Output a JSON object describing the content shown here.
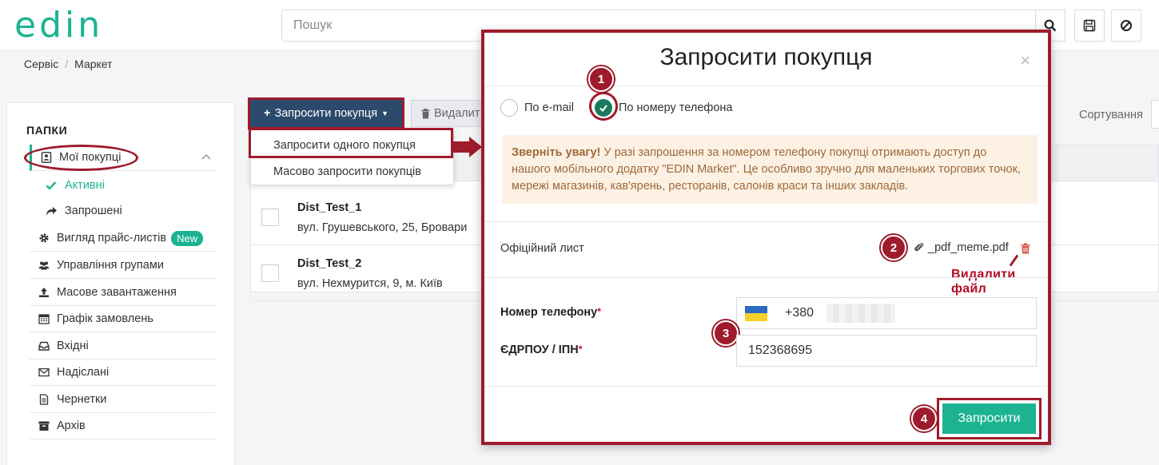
{
  "header": {
    "logo": "edin",
    "search_placeholder": "Пошук"
  },
  "breadcrumb": [
    "Сервіс",
    "Маркет"
  ],
  "sidebar": {
    "title": "ПАПКИ",
    "items": [
      {
        "label": "Мої покупці"
      },
      {
        "label": "Активні"
      },
      {
        "label": "Запрошені"
      },
      {
        "label": "Вигляд прайс-листів",
        "badge": "New"
      },
      {
        "label": "Управління групами"
      },
      {
        "label": "Масове завантаження"
      },
      {
        "label": "Графік замовлень"
      },
      {
        "label": "Вхідні"
      },
      {
        "label": "Надіслані"
      },
      {
        "label": "Чернетки"
      },
      {
        "label": "Архів"
      }
    ]
  },
  "toolbar": {
    "invite_label": "Запросити покупця",
    "delete_label": "Видалит",
    "sort_label": "Сортування"
  },
  "dropdown": {
    "items": [
      "Запросити одного покупця",
      "Масово запросити покупців"
    ]
  },
  "list": {
    "rows": [
      {
        "name": "Dist_Test_1",
        "address": "вул. Грушевського, 25, Бровари"
      },
      {
        "name": "Dist_Test_2",
        "address": "вул. Нехмурится, 9, м. Київ"
      }
    ]
  },
  "modal": {
    "title": "Запросити покупця",
    "close": "×",
    "radio_email": "По e-mail",
    "radio_phone": "По номеру телефона",
    "alert_bold": "Зверніть увагу!",
    "alert_text": " У разі запрошення за номером телефону покупці отримають доступ до нашого мобільного додатку \"EDIN Market\". Це особливо зручно для маленьких торгових точок, мережі магазинів, кав'ярень, ресторанів, салонів краси та інших закладів.",
    "official_letter_label": "Офіційний лист",
    "file_name": "_pdf_meme.pdf",
    "delete_file_label": "Видалити файл",
    "phone_label": "Номер телефону",
    "phone_prefix": "+380",
    "edrpou_label": "ЄДРПОУ / ІПН",
    "edrpou_value": "152368695",
    "required_mark": "*",
    "submit_label": "Запросити"
  },
  "annotations": {
    "step1": "1",
    "step2": "2",
    "step3": "3",
    "step4": "4"
  },
  "colors": {
    "brand_green": "#1bb392",
    "navy_button": "#2c4a6b",
    "annotation_red": "#9e1b2c"
  }
}
